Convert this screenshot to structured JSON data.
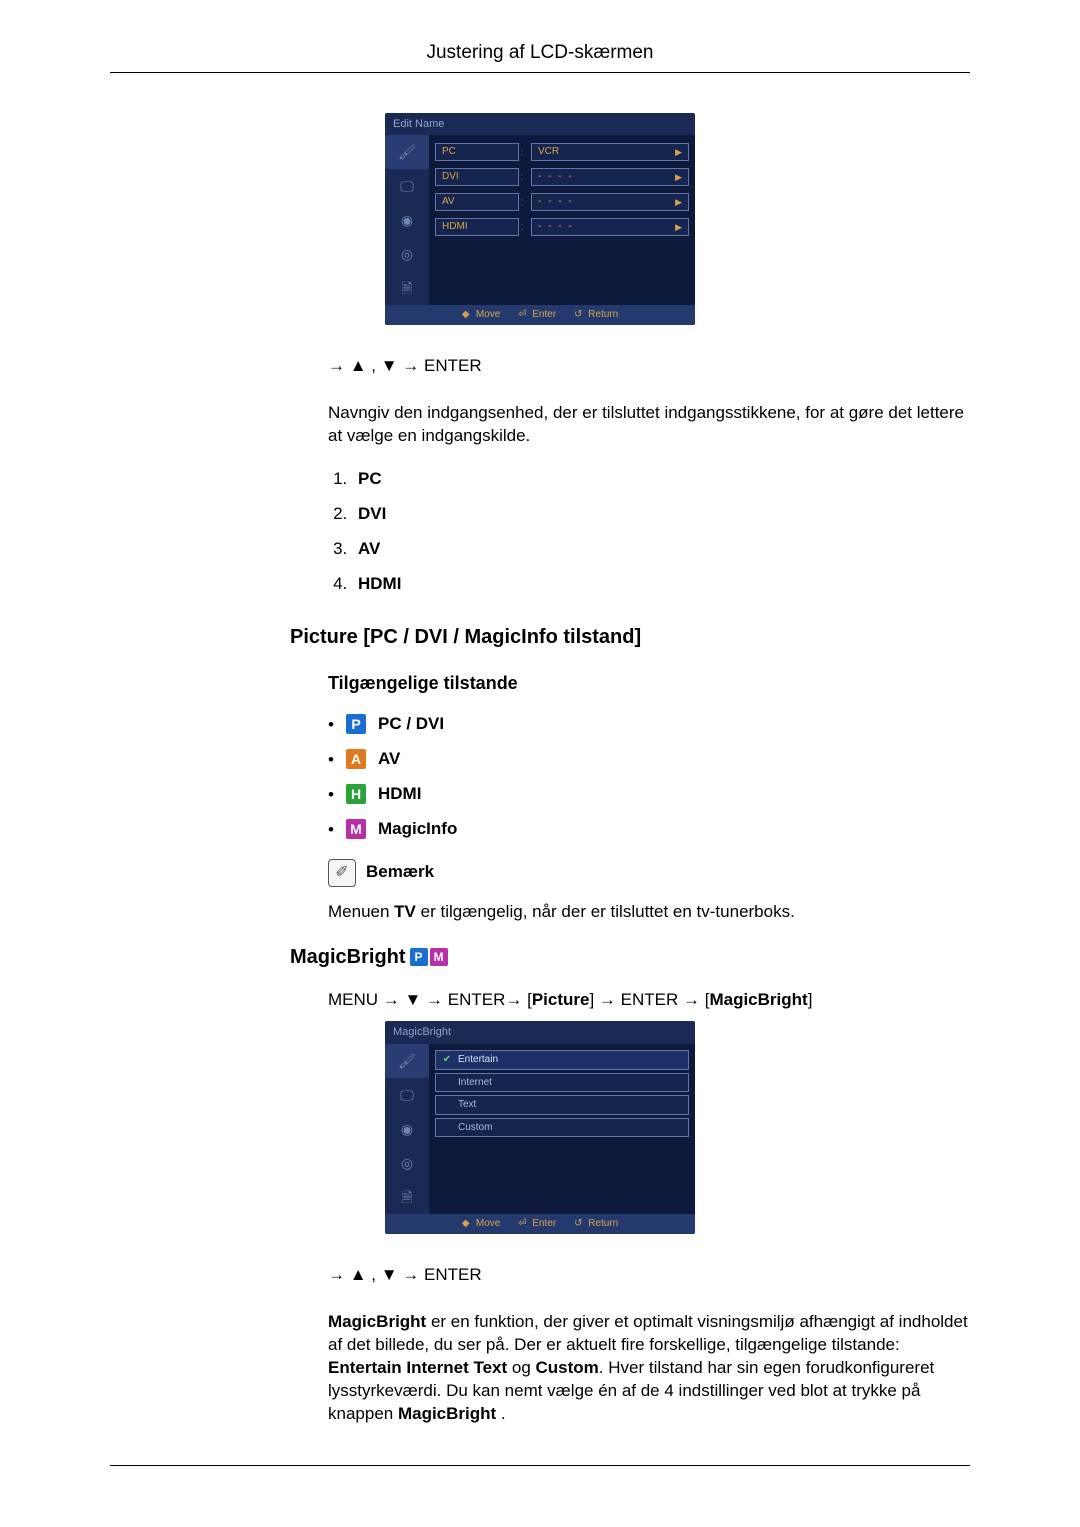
{
  "header": {
    "title": "Justering af LCD-skærmen"
  },
  "osd1": {
    "title": "Edit Name",
    "rows": [
      {
        "label": "PC",
        "value": "VCR",
        "dotted": false
      },
      {
        "label": "DVI",
        "value": "- - - -",
        "dotted": true
      },
      {
        "label": "AV",
        "value": "- - - -",
        "dotted": true
      },
      {
        "label": "HDMI",
        "value": "- - - -",
        "dotted": true
      }
    ],
    "footer": {
      "move": "Move",
      "enter": "Enter",
      "return": "Return"
    }
  },
  "nav1": "→ ▲ , ▼ → ENTER",
  "para1": "Navngiv den indgangsenhed, der er tilsluttet indgangsstikkene, for at gøre det lettere at vælge en indgangskilde.",
  "list1": [
    "PC",
    "DVI",
    "AV",
    "HDMI"
  ],
  "section1": "Picture [PC / DVI / MagicInfo tilstand]",
  "sub1": "Tilgængelige tilstande",
  "modes": [
    {
      "badge": "P",
      "cls": "p",
      "label": "PC / DVI"
    },
    {
      "badge": "A",
      "cls": "a",
      "label": "AV"
    },
    {
      "badge": "H",
      "cls": "h",
      "label": "HDMI"
    },
    {
      "badge": "M",
      "cls": "m",
      "label": "MagicInfo"
    }
  ],
  "note_label": "Bemærk",
  "note_text_pre": "Menuen ",
  "note_text_bold": "TV",
  "note_text_post": " er tilgængelig, når der er tilsluttet en tv-tunerboks.",
  "mb_heading": "MagicBright",
  "menu_path": {
    "pre": "MENU → ▼ → ENTER→ [",
    "a": "Picture",
    "mid": "] → ENTER → [",
    "b": "MagicBright",
    "post": "]"
  },
  "osd2": {
    "title": "MagicBright",
    "rows": [
      "Entertain",
      "Internet",
      "Text",
      "Custom"
    ],
    "selected": 0,
    "footer": {
      "move": "Move",
      "enter": "Enter",
      "return": "Return"
    }
  },
  "nav2": "→ ▲ , ▼ → ENTER",
  "para2_a": "MagicBright",
  "para2_b": " er en funktion, der giver et optimalt visningsmiljø afhængigt af indholdet af det billede, du ser på. Der er aktuelt fire forskellige, tilgængelige tilstande: ",
  "para2_c": "Entertain Internet Text",
  "para2_d": " og ",
  "para2_e": "Custom",
  "para2_f": ". Hver tilstand har sin egen forudkonfigureret lysstyrkeværdi. Du kan nemt vælge én af de 4 indstillinger ved blot at trykke på knappen ",
  "para2_g": "MagicBright",
  "para2_h": " ."
}
